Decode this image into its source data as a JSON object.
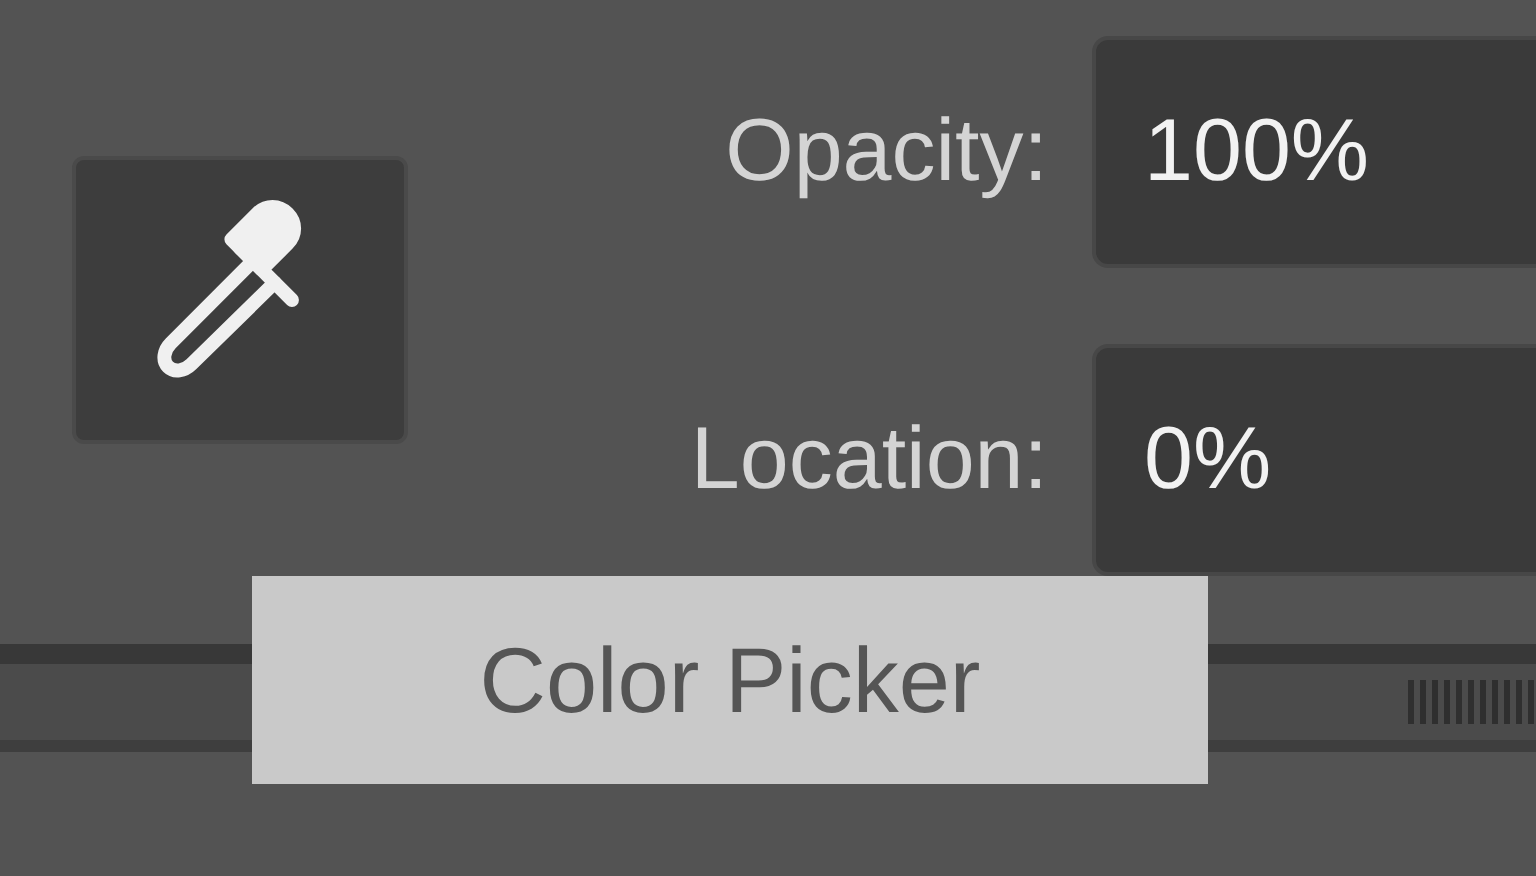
{
  "fields": [
    {
      "label": "Opacity:",
      "value": "100%"
    },
    {
      "label": "Location:",
      "value": "0%"
    }
  ],
  "tooltip": "Color Picker"
}
